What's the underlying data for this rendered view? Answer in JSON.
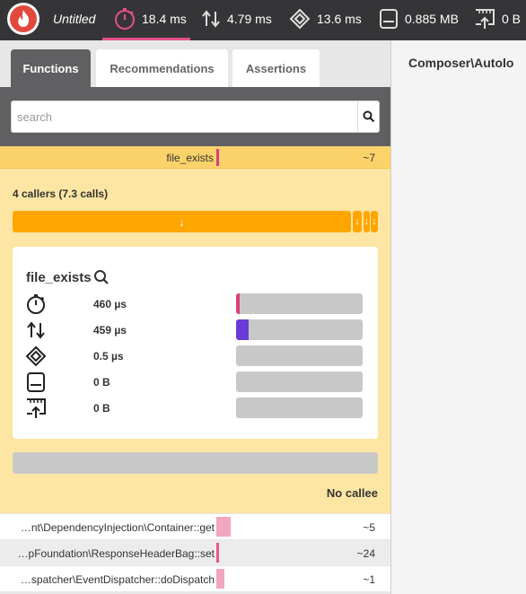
{
  "app": {
    "title": "Untitled"
  },
  "metrics": [
    {
      "icon": "stopwatch-icon",
      "value": "18.4 ms",
      "active": true
    },
    {
      "icon": "io-arrows-icon",
      "value": "4.79 ms"
    },
    {
      "icon": "cpu-icon",
      "value": "13.6 ms"
    },
    {
      "icon": "memory-icon",
      "value": "0.885 MB"
    },
    {
      "icon": "network-icon",
      "value": "0 B"
    }
  ],
  "tabs": [
    "Functions",
    "Recommendations",
    "Assertions"
  ],
  "search": {
    "placeholder": "search",
    "value": ""
  },
  "selected_function": {
    "name": "file_exists",
    "count": "~7"
  },
  "callers": {
    "title": "4 callers (7.3 calls)",
    "main_arrow": "↓",
    "small_arrows": [
      "↓",
      "↓",
      "↓"
    ]
  },
  "details": {
    "name": "file_exists",
    "stats": [
      {
        "icon": "stopwatch-icon",
        "value": "460 µs",
        "fill_fraction": 0.03,
        "color": "#d8407a"
      },
      {
        "icon": "io-arrows-icon",
        "value": "459 µs",
        "fill_fraction": 0.1,
        "color": "#6a3bd6"
      },
      {
        "icon": "cpu-icon",
        "value": "0.5 µs",
        "fill_fraction": 0
      },
      {
        "icon": "memory-icon",
        "value": "0 B",
        "fill_fraction": 0
      },
      {
        "icon": "network-icon",
        "value": "0 B",
        "fill_fraction": 0
      }
    ]
  },
  "callees": {
    "empty_label": "No callee"
  },
  "rows": [
    {
      "name": "…nt\\DependencyInjection\\Container::get",
      "count": "~5",
      "bar_color": "#f2a6c2"
    },
    {
      "name": "…pFoundation\\ResponseHeaderBag::set",
      "count": "~24",
      "bar_color": "#e8558f"
    },
    {
      "name": "…spatcher\\EventDispatcher::doDispatch",
      "count": "~1",
      "bar_color": "#f2a6c2"
    }
  ],
  "right_panel": {
    "title": "Composer\\Autolo"
  }
}
